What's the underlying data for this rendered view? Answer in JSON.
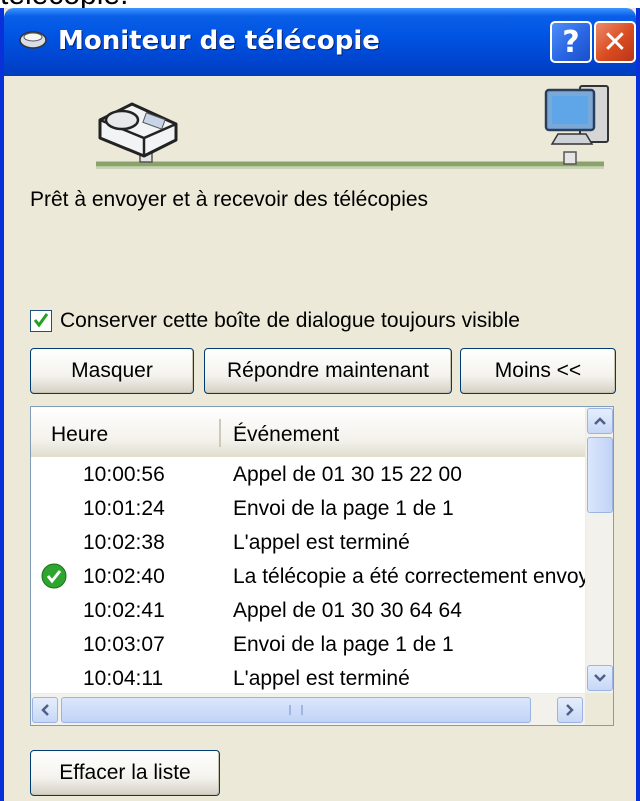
{
  "page_top_text": "télécopie.",
  "window": {
    "title": "Moniteur de télécopie",
    "help_label": "?",
    "close_label": "✕"
  },
  "illustration": {
    "left_icon": "fax-machine-icon",
    "right_icon": "computer-icon"
  },
  "status": {
    "message": "Prêt à envoyer et à recevoir des télécopies"
  },
  "keep_visible": {
    "label": "Conserver cette boîte de dialogue toujours visible",
    "checked": true
  },
  "buttons": {
    "hide": "Masquer",
    "answer_now": "Répondre maintenant",
    "less": "Moins <<",
    "clear_list": "Effacer la liste"
  },
  "event_list": {
    "columns": [
      "Heure",
      "Événement"
    ],
    "rows": [
      {
        "time": "10:00:56",
        "event": "Appel de 01 30 15 22 00",
        "icon": ""
      },
      {
        "time": "10:01:24",
        "event": "Envoi de la page 1 de 1",
        "icon": ""
      },
      {
        "time": "10:02:38",
        "event": "L'appel est terminé",
        "icon": ""
      },
      {
        "time": "10:02:40",
        "event": "La télécopie a été correctement envoyée",
        "icon": "success-check-icon"
      },
      {
        "time": "10:02:41",
        "event": "Appel de 01 30 30 64 64",
        "icon": ""
      },
      {
        "time": "10:03:07",
        "event": "Envoi de la page 1 de 1",
        "icon": ""
      },
      {
        "time": "10:04:11",
        "event": "L'appel est terminé",
        "icon": ""
      }
    ]
  },
  "colors": {
    "title_bar": "#0054e3",
    "window_bg": "#ece9d8",
    "close_button": "#d94b20",
    "success": "#2ea52e"
  }
}
